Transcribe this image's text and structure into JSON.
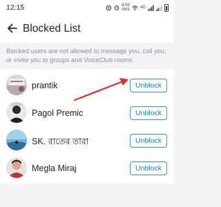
{
  "status_bar": {
    "time": "12:15",
    "speed_value": "4.00",
    "speed_unit": "KB/S",
    "network_label": "4G"
  },
  "header": {
    "title": "Blocked List",
    "back_icon": "arrow-left-icon"
  },
  "info_note": "Blocked users are not allowed to message you, call you, or invite you to groups and VoiceClub rooms.",
  "blocked_users": [
    {
      "name": "prantik",
      "button_label": "Unblock"
    },
    {
      "name": "Pagol Premic",
      "button_label": "Unblock"
    },
    {
      "name": "SK. রাতের তারা",
      "button_label": "Unblock"
    },
    {
      "name": "Megla Miraj",
      "button_label": "Unblock"
    }
  ],
  "colors": {
    "accent": "#2a7fc4",
    "annotation_arrow": "#d9302c",
    "background": "#f4f4f6"
  }
}
